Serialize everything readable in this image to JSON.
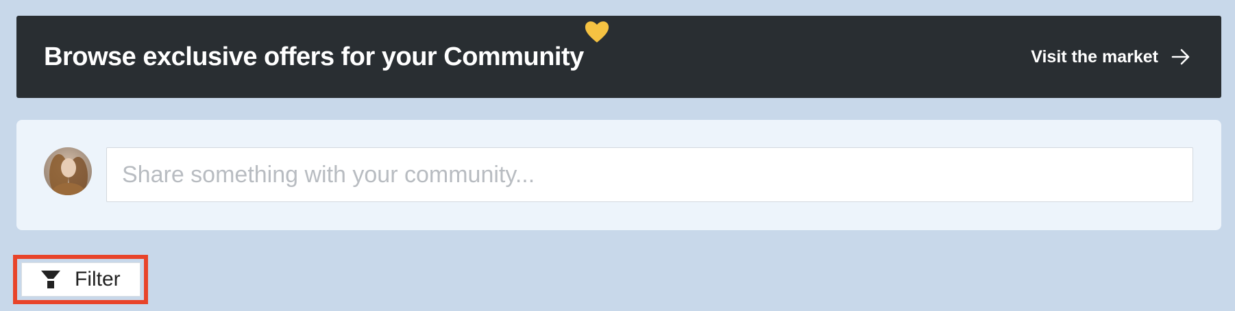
{
  "banner": {
    "title": "Browse exclusive offers for your Community",
    "link_label": "Visit the market",
    "heart_icon": "heart-icon",
    "arrow_icon": "arrow-right-icon",
    "background_color": "#292e32",
    "heart_color": "#f5c242"
  },
  "composer": {
    "avatar": "user-avatar",
    "placeholder": "Share something with your community...",
    "value": ""
  },
  "filter": {
    "label": "Filter",
    "icon": "funnel-icon",
    "highlight_color": "#e8442a"
  }
}
